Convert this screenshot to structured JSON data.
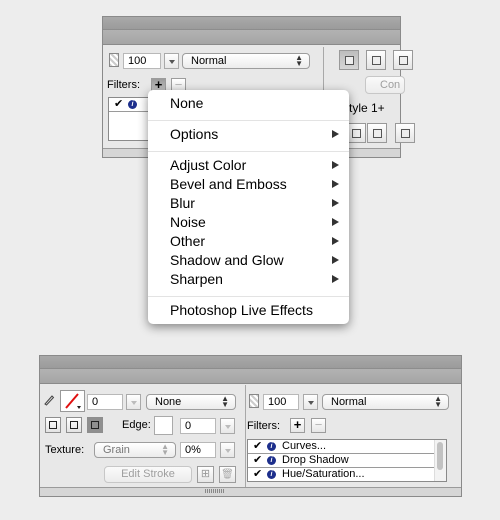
{
  "top_panel": {
    "opacity_value": "100",
    "blend_mode": "Normal",
    "filters_label": "Filters:",
    "add_filter_icon": "plus-icon",
    "remove_filter_icon": "minus-icon",
    "partial_button_label": "Con",
    "partial_style_label": "tyle 1+",
    "filter_list_header_icons": [
      "checkmark-icon",
      "info-icon"
    ]
  },
  "filters_menu": {
    "items": [
      {
        "label": "None",
        "submenu": false
      },
      {
        "label": "Options",
        "submenu": true
      },
      {
        "label": "Adjust Color",
        "submenu": true
      },
      {
        "label": "Bevel and Emboss",
        "submenu": true
      },
      {
        "label": "Blur",
        "submenu": true
      },
      {
        "label": "Noise",
        "submenu": true
      },
      {
        "label": "Other",
        "submenu": true
      },
      {
        "label": "Shadow and Glow",
        "submenu": true
      },
      {
        "label": "Sharpen",
        "submenu": true
      },
      {
        "label": "Photoshop Live Effects",
        "submenu": false
      }
    ]
  },
  "bottom_panel": {
    "stroke": {
      "pencil_icon": "pencil-icon",
      "stroke_color": "#e01010",
      "stroke_size": "0",
      "stroke_type": "None",
      "edge_label": "Edge:",
      "edge_value": "0",
      "texture_label": "Texture:",
      "texture_type": "Grain",
      "texture_amount": "0%",
      "edit_stroke_label": "Edit Stroke"
    },
    "opacity_value": "100",
    "blend_mode": "Normal",
    "filters_label": "Filters:",
    "filters": [
      {
        "enabled": true,
        "name": "Curves..."
      },
      {
        "enabled": true,
        "name": "Drop Shadow"
      },
      {
        "enabled": true,
        "name": "Hue/Saturation..."
      }
    ]
  }
}
